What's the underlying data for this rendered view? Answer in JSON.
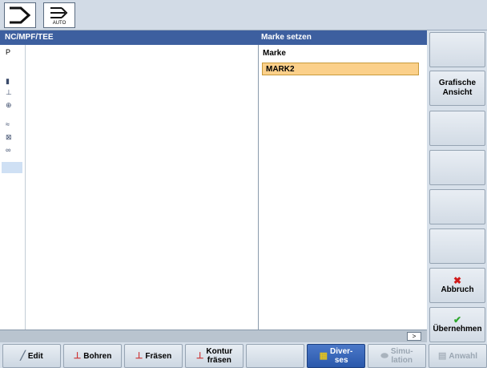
{
  "topbar": {
    "mode_icon_1": "arrow-right-icon",
    "mode_icon_2": "auto-arrow-icon",
    "mode_label": "AUTO"
  },
  "header": {
    "path": "NC/MPF/TEE",
    "dialog_title": "Marke setzen"
  },
  "editor": {
    "gutter_top": "P"
  },
  "panel": {
    "label": "Marke",
    "value": "MARK2"
  },
  "strip": {
    "more": ">"
  },
  "vertical_softkeys": [
    {
      "label": ""
    },
    {
      "label": "Grafische Ansicht"
    },
    {
      "label": ""
    },
    {
      "label": ""
    },
    {
      "label": ""
    },
    {
      "label": ""
    },
    {
      "label": "Abbruch",
      "icon": "x-icon"
    },
    {
      "label": "Übernehmen",
      "icon": "checkmark-icon"
    }
  ],
  "horizontal_softkeys": [
    {
      "label": "Edit",
      "icon": "pencil-icon"
    },
    {
      "label": "Bohren",
      "icon": "drill-icon"
    },
    {
      "label": "Fräsen",
      "icon": "mill-icon"
    },
    {
      "label": "Kontur fräsen",
      "line1": "Kontur",
      "line2": "fräsen",
      "icon": "contour-mill-icon"
    },
    {
      "label": ""
    },
    {
      "label": "Diverses",
      "line1": "Diver-",
      "line2": "ses",
      "icon": "misc-icon",
      "active": true
    },
    {
      "label": "Simulation",
      "line1": "Simu-",
      "line2": "lation",
      "icon": "simulation-icon",
      "disabled": true
    },
    {
      "label": "Anwahl",
      "icon": "select-icon",
      "disabled": true
    }
  ],
  "colors": {
    "header_bg": "#3d5f9f",
    "field_highlight": "#fbd08a",
    "active_softkey": "#2a58ab",
    "cancel_icon": "#d01a1a",
    "accept_icon": "#2ea82e"
  }
}
